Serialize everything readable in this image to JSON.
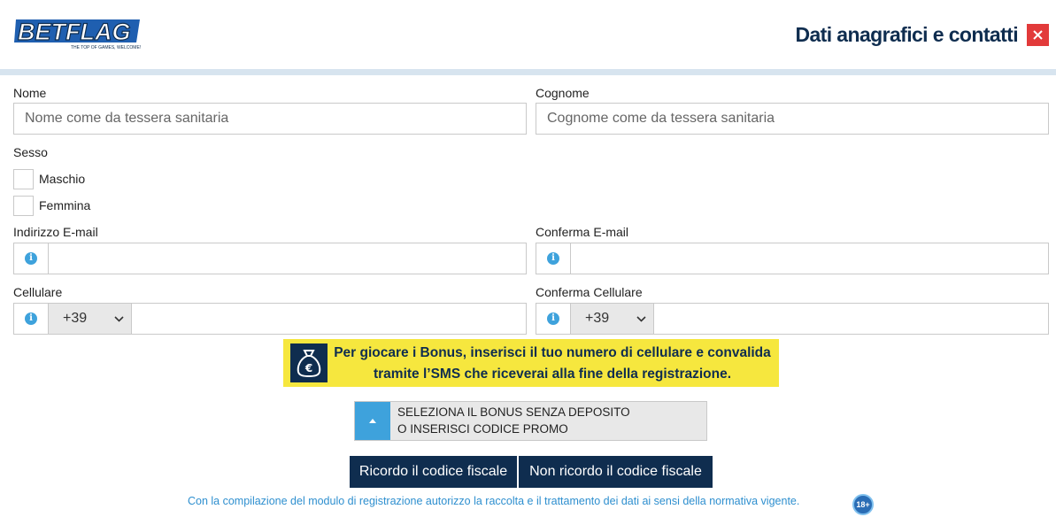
{
  "header": {
    "logo_text": "BETFLAG",
    "logo_tagline": "THE TOP OF GAMES, WELCOME!",
    "title": "Dati anagrafici e contatti",
    "close_icon": "close-icon"
  },
  "form": {
    "nome": {
      "label": "Nome",
      "placeholder": "Nome come da tessera sanitaria",
      "value": ""
    },
    "cognome": {
      "label": "Cognome",
      "placeholder": "Cognome come da tessera sanitaria",
      "value": ""
    },
    "sesso": {
      "label": "Sesso",
      "options": [
        {
          "label": "Maschio",
          "checked": false
        },
        {
          "label": "Femmina",
          "checked": false
        }
      ]
    },
    "email": {
      "label": "Indirizzo E-mail",
      "value": "",
      "info_icon": "info-icon"
    },
    "email_confirm": {
      "label": "Conferma E-mail",
      "value": "",
      "info_icon": "info-icon"
    },
    "cellulare": {
      "label": "Cellulare",
      "prefix": "+39",
      "value": ""
    },
    "cellulare_confirm": {
      "label": "Conferma Cellulare",
      "prefix": "+39",
      "value": ""
    }
  },
  "bonus_banner": {
    "icon": "money-bag-euro-icon",
    "line1": "Per giocare i Bonus, inserisci il tuo numero di cellulare e convalida",
    "line2": "tramite l’SMS che riceverai alla fine della registrazione."
  },
  "promo": {
    "toggle_icon": "caret-up-icon",
    "line1": "SELEZIONA IL BONUS SENZA DEPOSITO",
    "line2": "O INSERISCI CODICE PROMO"
  },
  "buttons": {
    "remember_cf": "Ricordo il codice fiscale",
    "forgot_cf": "Non ricordo il codice fiscale"
  },
  "footer": {
    "note": "Con la compilazione del modulo di registrazione autorizzo la raccolta e il trattamento dei dati ai sensi della normativa vigente.",
    "age_badge": "18+"
  },
  "colors": {
    "brand_navy": "#0f2d4f",
    "accent_blue": "#3ea2dc",
    "banner_yellow": "#f6e73e",
    "close_red": "#e23a3a",
    "divider": "#d7e4ef"
  }
}
